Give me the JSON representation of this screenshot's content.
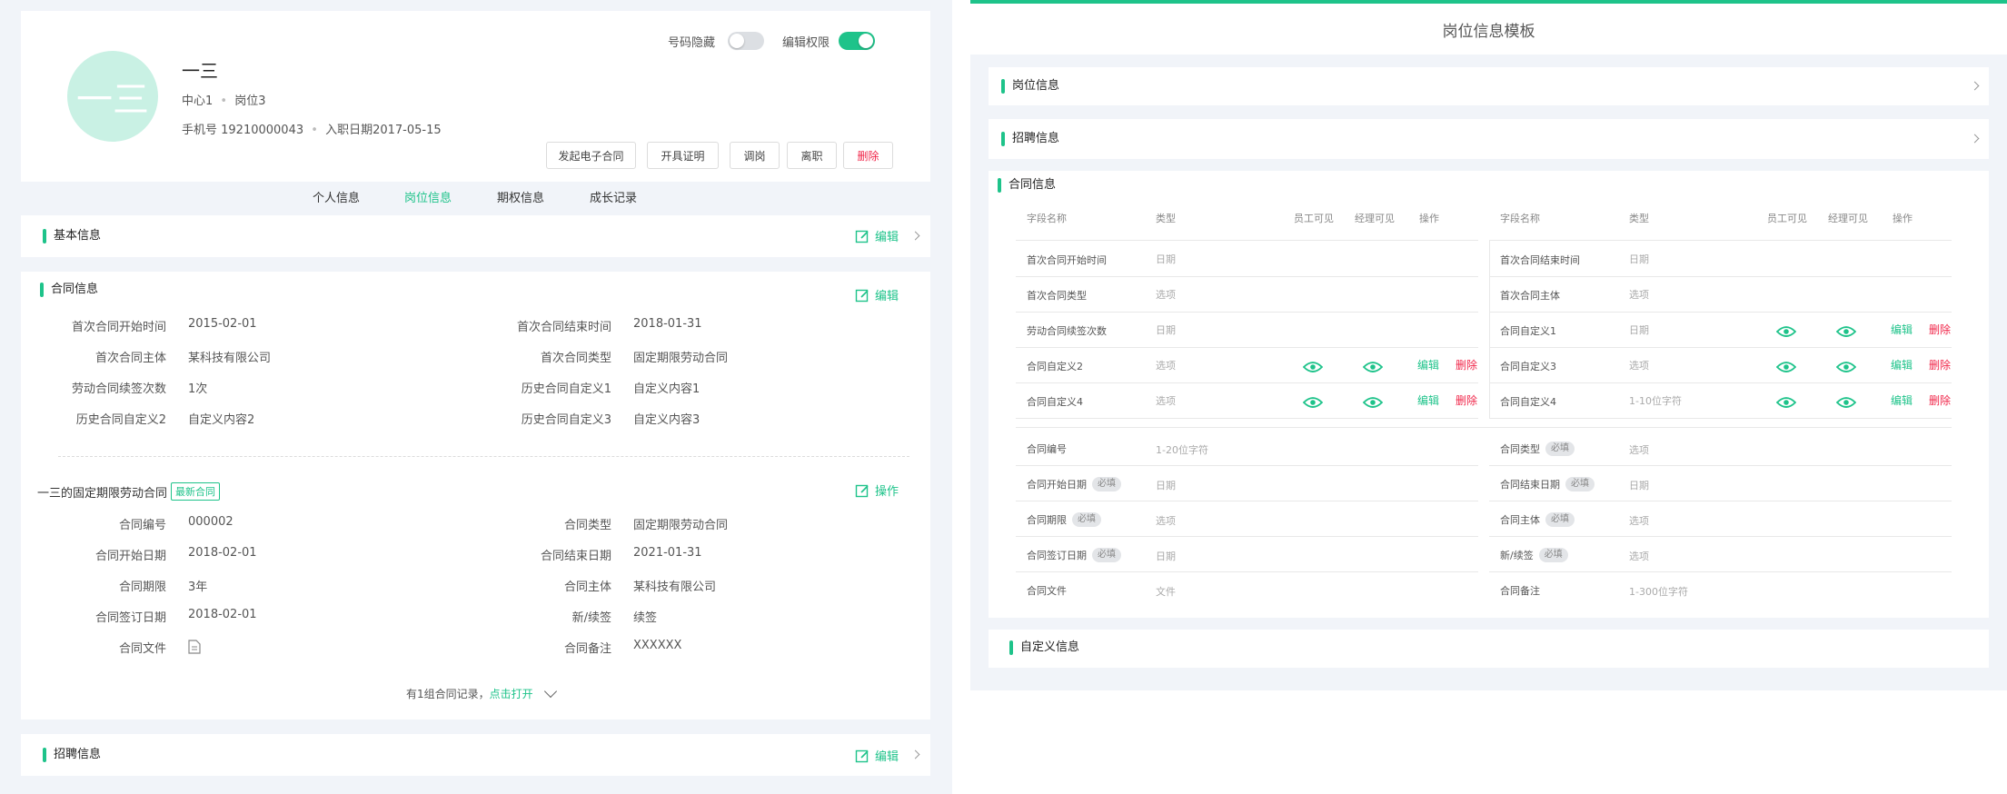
{
  "profile": {
    "avatar_text": "一三",
    "name": "一三",
    "dept": "中心1",
    "position": "岗位3",
    "dot": "•",
    "phone": "手机号 19210000043",
    "join": "入职日期2017-05-15",
    "hide_label": "号码隐藏",
    "edit_label": "编辑权限",
    "hide_on": false,
    "edit_on": true,
    "actions": [
      "发起电子合同",
      "开具证明",
      "调岗",
      "离职",
      "删除"
    ]
  },
  "tabs": [
    "个人信息",
    "岗位信息",
    "期权信息",
    "成长记录"
  ],
  "active_tab": "岗位信息",
  "basic": {
    "title": "基本信息",
    "edit": "编辑"
  },
  "contract": {
    "title": "合同信息",
    "edit": "编辑",
    "summary": [
      {
        "l1": "首次合同开始时间",
        "v1": "2015-02-01",
        "l2": "首次合同结束时间",
        "v2": "2018-01-31"
      },
      {
        "l1": "首次合同主体",
        "v1": "某科技有限公司",
        "l2": "首次合同类型",
        "v2": "固定期限劳动合同"
      },
      {
        "l1": "劳动合同续签次数",
        "v1": "1次",
        "l2": "历史合同自定义1",
        "v2": "自定义内容1"
      },
      {
        "l1": "历史合同自定义2",
        "v1": "自定义内容2",
        "l2": "历史合同自定义3",
        "v2": "自定义内容3"
      }
    ],
    "latest_title": "一三的固定期限劳动合同",
    "latest_badge": "最新合同",
    "latest_action": "操作",
    "latest": [
      {
        "l1": "合同编号",
        "v1": "000002",
        "l2": "合同类型",
        "v2": "固定期限劳动合同"
      },
      {
        "l1": "合同开始日期",
        "v1": "2018-02-01",
        "l2": "合同结束日期",
        "v2": "2021-01-31"
      },
      {
        "l1": "合同期限",
        "v1": "3年",
        "l2": "合同主体",
        "v2": "某科技有限公司"
      },
      {
        "l1": "合同签订日期",
        "v1": "2018-02-01",
        "l2": "新/续签",
        "v2": "续签"
      },
      {
        "l1": "合同文件",
        "v1": "",
        "l2": "合同备注",
        "v2": "XXXXXX"
      }
    ],
    "history_text": "有1组合同记录，",
    "history_link": "点击打开"
  },
  "recruit": {
    "title": "招聘信息",
    "edit": "编辑"
  },
  "template": {
    "title": "岗位信息模板",
    "sections": [
      "岗位信息",
      "招聘信息"
    ],
    "contract_title": "合同信息",
    "custom_title": "自定义信息",
    "headers": [
      "字段名称",
      "类型",
      "员工可见",
      "经理可见",
      "操作"
    ],
    "left_rows": [
      {
        "name": "首次合同开始时间",
        "type": "日期",
        "ops": false
      },
      {
        "name": "首次合同类型",
        "type": "选项",
        "ops": false
      },
      {
        "name": "劳动合同续签次数",
        "type": "日期",
        "ops": false
      },
      {
        "name": "合同自定义2",
        "type": "选项",
        "ops": true
      },
      {
        "name": "合同自定义4",
        "type": "选项",
        "ops": true
      }
    ],
    "right_rows": [
      {
        "name": "首次合同结束时间",
        "type": "日期",
        "ops": false
      },
      {
        "name": "首次合同主体",
        "type": "选项",
        "ops": false
      },
      {
        "name": "合同自定义1",
        "type": "日期",
        "ops": true
      },
      {
        "name": "合同自定义3",
        "type": "选项",
        "ops": true
      },
      {
        "name": "合同自定义4",
        "type": "1-10位字符",
        "ops": true
      }
    ],
    "edit": "编辑",
    "delete": "删除",
    "required": "必填",
    "form_rows": [
      {
        "l": "合同编号",
        "lreq": false,
        "lt": "1-20位字符",
        "r": "合同类型",
        "rreq": true,
        "rt": "选项"
      },
      {
        "l": "合同开始日期",
        "lreq": true,
        "lt": "日期",
        "r": "合同结束日期",
        "rreq": true,
        "rt": "日期"
      },
      {
        "l": "合同期限",
        "lreq": true,
        "lt": "选项",
        "r": "合同主体",
        "rreq": true,
        "rt": "选项"
      },
      {
        "l": "合同签订日期",
        "lreq": true,
        "lt": "日期",
        "r": "新/续签",
        "rreq": true,
        "rt": "选项"
      },
      {
        "l": "合同文件",
        "lreq": false,
        "lt": "文件",
        "r": "合同备注",
        "rreq": false,
        "rt": "1-300位字符"
      }
    ]
  },
  "colors": {
    "accent": "#1ec38a",
    "danger": "#f0274a",
    "avatar": "#c9f1e4"
  }
}
